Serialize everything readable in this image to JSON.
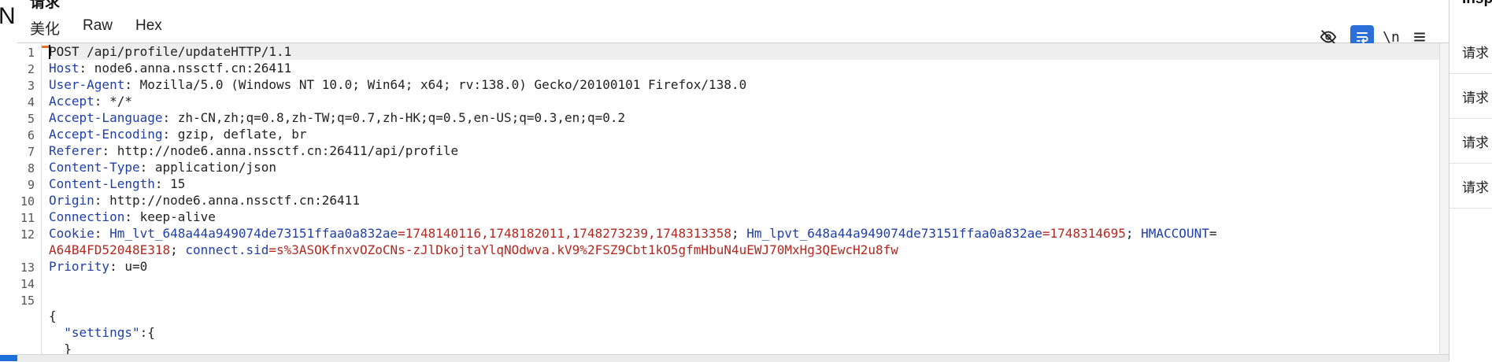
{
  "left_panel": {
    "letter": "N"
  },
  "request_panel": {
    "title": "请求",
    "tabs": [
      {
        "label": "美化",
        "active": true
      },
      {
        "label": "Raw",
        "active": false
      },
      {
        "label": "Hex",
        "active": false
      }
    ],
    "toolbar": {
      "hide_icon": "eye-off-icon",
      "wrap_icon": "wrap-lines-icon",
      "newline_label": "\\n",
      "menu_icon": "hamburger-menu-icon",
      "accent_color": "#2b6fd8"
    }
  },
  "editor": {
    "lines": [
      {
        "num": "1",
        "parts": [
          {
            "t": "POST /api/profile/updateHTTP/1.1",
            "c": "v"
          }
        ]
      },
      {
        "num": "2",
        "parts": [
          {
            "t": "Host",
            "c": "k"
          },
          {
            "t": ": node6.anna.nssctf.cn:26411",
            "c": "v"
          }
        ]
      },
      {
        "num": "3",
        "parts": [
          {
            "t": "User-Agent",
            "c": "k"
          },
          {
            "t": ": Mozilla/5.0 (Windows NT 10.0; Win64; x64; rv:138.0) Gecko/20100101 Firefox/138.0",
            "c": "v"
          }
        ]
      },
      {
        "num": "4",
        "parts": [
          {
            "t": "Accept",
            "c": "k"
          },
          {
            "t": ": */*",
            "c": "v"
          }
        ]
      },
      {
        "num": "5",
        "parts": [
          {
            "t": "Accept-Language",
            "c": "k"
          },
          {
            "t": ": zh-CN,zh;q=0.8,zh-TW;q=0.7,zh-HK;q=0.5,en-US;q=0.3,en;q=0.2",
            "c": "v"
          }
        ]
      },
      {
        "num": "6",
        "parts": [
          {
            "t": "Accept-Encoding",
            "c": "k"
          },
          {
            "t": ": gzip, deflate, br",
            "c": "v"
          }
        ]
      },
      {
        "num": "7",
        "parts": [
          {
            "t": "Referer",
            "c": "k"
          },
          {
            "t": ": http://node6.anna.nssctf.cn:26411/api/profile",
            "c": "v"
          }
        ]
      },
      {
        "num": "8",
        "parts": [
          {
            "t": "Content-Type",
            "c": "k"
          },
          {
            "t": ": application/json",
            "c": "v"
          }
        ]
      },
      {
        "num": "9",
        "parts": [
          {
            "t": "Content-Length",
            "c": "k"
          },
          {
            "t": ": 15",
            "c": "v"
          }
        ]
      },
      {
        "num": "10",
        "parts": [
          {
            "t": "Origin",
            "c": "k"
          },
          {
            "t": ": http://node6.anna.nssctf.cn:26411",
            "c": "v"
          }
        ]
      },
      {
        "num": "11",
        "parts": [
          {
            "t": "Connection",
            "c": "k"
          },
          {
            "t": ": keep-alive",
            "c": "v"
          }
        ]
      },
      {
        "num": "12",
        "parts": [
          {
            "t": "Cookie",
            "c": "k"
          },
          {
            "t": ": ",
            "c": "v"
          },
          {
            "t": "Hm_lvt_648a44a949074de73151ffaa0a832ae",
            "c": "k"
          },
          {
            "t": "=1748140116,1748182011,1748273239,1748313358",
            "c": "c"
          },
          {
            "t": "; ",
            "c": "v"
          },
          {
            "t": "Hm_lpvt_648a44a949074de73151ffaa0a832ae",
            "c": "k"
          },
          {
            "t": "=1748314695",
            "c": "c"
          },
          {
            "t": "; ",
            "c": "v"
          },
          {
            "t": "HMACCOUNT",
            "c": "k"
          },
          {
            "t": "=",
            "c": "v"
          }
        ]
      },
      {
        "num": "",
        "parts": [
          {
            "t": "A64B4FD52048E318",
            "c": "c"
          },
          {
            "t": "; ",
            "c": "v"
          },
          {
            "t": "connect.sid",
            "c": "k"
          },
          {
            "t": "=s%3ASOKfnxvOZoCNs-zJlDkojtaYlqNOdwva.kV9%2FSZ9Cbt1kO5gfmHbuN4uEWJ70MxHg3QEwcH2u8fw",
            "c": "c"
          }
        ]
      },
      {
        "num": "13",
        "parts": [
          {
            "t": "Priority",
            "c": "k"
          },
          {
            "t": ": u=0",
            "c": "v"
          }
        ]
      },
      {
        "num": "14",
        "parts": [
          {
            "t": "",
            "c": "v"
          }
        ]
      },
      {
        "num": "15",
        "parts": [
          {
            "t": "",
            "c": "v"
          }
        ]
      },
      {
        "num": "",
        "parts": [
          {
            "t": "{",
            "c": "v"
          }
        ]
      },
      {
        "num": "",
        "parts": [
          {
            "t": "  ",
            "c": "v"
          },
          {
            "t": "\"settings\"",
            "c": "k"
          },
          {
            "t": ":{",
            "c": "v"
          }
        ]
      },
      {
        "num": "",
        "parts": [
          {
            "t": "  }",
            "c": "v"
          }
        ]
      },
      {
        "num": "",
        "parts": [
          {
            "t": "}",
            "c": "v"
          }
        ]
      }
    ]
  },
  "inspector": {
    "title": "Insp",
    "items": [
      "请求",
      "请求",
      "请求",
      "请求"
    ]
  }
}
